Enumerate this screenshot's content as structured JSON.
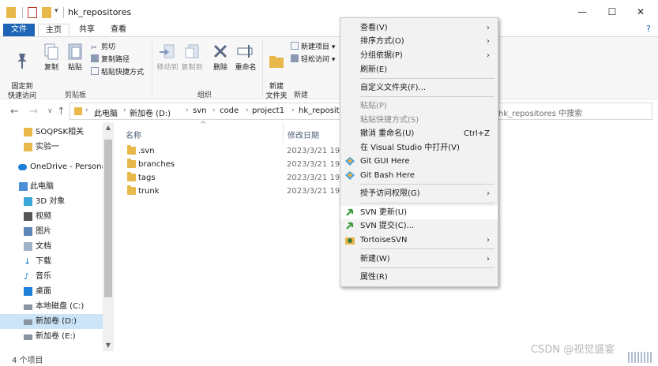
{
  "window": {
    "title": "hk_repositores",
    "minimize": "—",
    "maximize": "☐",
    "close": "✕",
    "help": "?"
  },
  "ribbon": {
    "tabs": [
      "文件",
      "主页",
      "共享",
      "查看"
    ],
    "clipboard": {
      "pin": "固定到\n快速访问",
      "copy": "复制",
      "paste": "粘贴",
      "cut": "剪切",
      "copy_path": "复制路径",
      "paste_shortcut": "粘贴快捷方式",
      "group": "剪贴板"
    },
    "organize": {
      "move_to": "移动到",
      "copy_to": "复制到",
      "delete": "删除",
      "rename": "重命名",
      "group": "组织"
    },
    "new": {
      "new_folder": "新建\n文件夹",
      "new_item": "新建项目 ▾",
      "easy_access": "轻松访问 ▾",
      "group": "新建"
    }
  },
  "address": {
    "back": "←",
    "forward": "→",
    "recent": "∨",
    "up": "↑",
    "path": [
      "此电脑",
      "新加卷 (D:)",
      "svn",
      "code",
      "project1",
      "hk_repositores"
    ],
    "search_placeholder": "hk_repositores 中搜索"
  },
  "nav": {
    "items": [
      {
        "label": "SOQPSK相关",
        "icon": "folder-icon"
      },
      {
        "label": "实验一",
        "icon": "folder-icon"
      },
      {
        "label": "OneDrive - Personal",
        "icon": "cloud-icon"
      },
      {
        "label": "此电脑",
        "icon": "computer-icon"
      },
      {
        "label": "3D 对象",
        "icon": "cube-icon"
      },
      {
        "label": "视频",
        "icon": "video-icon"
      },
      {
        "label": "图片",
        "icon": "picture-icon"
      },
      {
        "label": "文档",
        "icon": "document-icon"
      },
      {
        "label": "下载",
        "icon": "download-icon"
      },
      {
        "label": "音乐",
        "icon": "music-icon"
      },
      {
        "label": "桌面",
        "icon": "desktop-icon"
      },
      {
        "label": "本地磁盘 (C:)",
        "icon": "drive-icon"
      },
      {
        "label": "新加卷 (D:)",
        "icon": "drive-icon"
      },
      {
        "label": "新加卷 (E:)",
        "icon": "drive-icon"
      }
    ],
    "selected_index": 12
  },
  "list": {
    "columns": {
      "name": "名称",
      "date": "修改日期"
    },
    "sort_indicator": "^",
    "rows": [
      {
        "name": ".svn",
        "date": "2023/3/21 19:"
      },
      {
        "name": "branches",
        "date": "2023/3/21 19:"
      },
      {
        "name": "tags",
        "date": "2023/3/21 19:"
      },
      {
        "name": "trunk",
        "date": "2023/3/21 19:"
      }
    ]
  },
  "status": {
    "count": "4 个项目"
  },
  "watermark": "CSDN @视觉盛宴",
  "context_menu": {
    "items": [
      {
        "label": "查看(V)",
        "submenu": true
      },
      {
        "label": "排序方式(O)",
        "submenu": true
      },
      {
        "label": "分组依据(P)",
        "submenu": true
      },
      {
        "label": "刷新(E)"
      },
      {
        "sep": true
      },
      {
        "label": "自定义文件夹(F)..."
      },
      {
        "sep": true
      },
      {
        "label": "粘贴(P)",
        "disabled": true
      },
      {
        "label": "粘贴快捷方式(S)",
        "disabled": true
      },
      {
        "label": "撤消 重命名(U)",
        "shortcut": "Ctrl+Z"
      },
      {
        "label": "在 Visual Studio 中打开(V)"
      },
      {
        "label": "Git GUI Here",
        "icon": "git-icon"
      },
      {
        "label": "Git Bash Here",
        "icon": "git-icon"
      },
      {
        "sep": true
      },
      {
        "label": "授予访问权限(G)",
        "submenu": true
      },
      {
        "sep": true
      },
      {
        "label": "SVN 更新(U)",
        "icon": "svn-update-icon",
        "hover": true
      },
      {
        "label": "SVN 提交(C)...",
        "icon": "svn-commit-icon"
      },
      {
        "label": "TortoiseSVN",
        "icon": "tortoise-icon",
        "submenu": true
      },
      {
        "sep": true
      },
      {
        "label": "新建(W)",
        "submenu": true
      },
      {
        "sep": true
      },
      {
        "label": "属性(R)"
      }
    ],
    "submenu_arrow": "›"
  },
  "colors": {
    "accent": "#1e65b8",
    "hover": "#cce4f7",
    "folder": "#e8b84a"
  }
}
